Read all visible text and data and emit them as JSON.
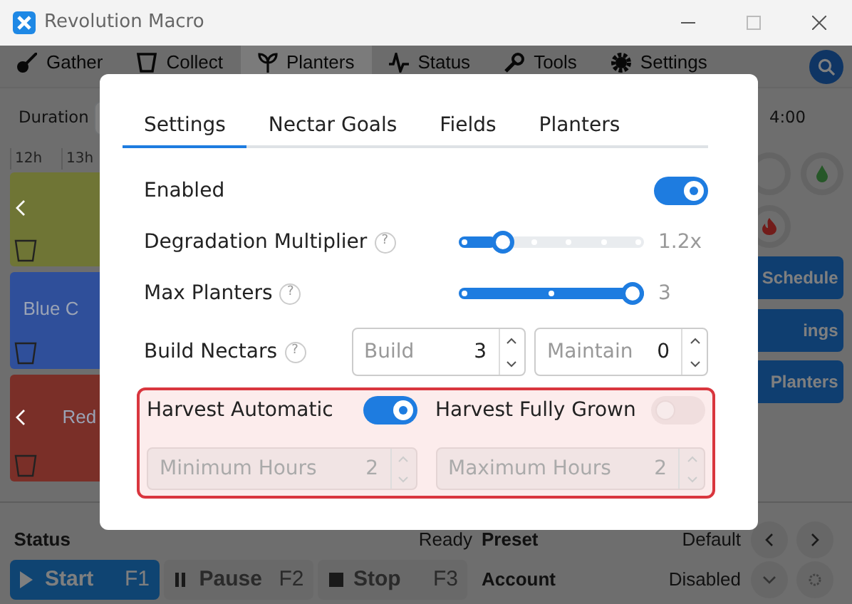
{
  "window": {
    "title": "Revolution Macro"
  },
  "nav_tabs": [
    {
      "label": "Gather",
      "selected": false
    },
    {
      "label": "Collect",
      "selected": false
    },
    {
      "label": "Planters",
      "selected": true
    },
    {
      "label": "Status",
      "selected": false
    },
    {
      "label": "Tools",
      "selected": false
    },
    {
      "label": "Settings",
      "selected": false
    }
  ],
  "toolbar": {
    "duration_label": "Duration",
    "time": "4:00"
  },
  "timeline": {
    "hours": [
      "12h",
      "13h"
    ],
    "planters": [
      {
        "color": "#6f7535"
      },
      {
        "label": "Blue C",
        "color": "#2f4f9a"
      },
      {
        "label": "Red",
        "color": "#7a2f28"
      }
    ]
  },
  "side_panel": {
    "buttons": [
      "Schedule",
      "ings",
      "Planters"
    ]
  },
  "status_bar": {
    "status_label": "Status",
    "status": "Ready",
    "preset_label": "Preset",
    "preset": "Default",
    "account_label": "Account",
    "account": "Disabled",
    "controls": [
      {
        "kind": "start",
        "label": "Start",
        "key": "F1"
      },
      {
        "kind": "pause",
        "label": "Pause",
        "key": "F2"
      },
      {
        "kind": "stop",
        "label": "Stop",
        "key": "F3"
      }
    ]
  },
  "dialog": {
    "tabs": [
      {
        "label": "Settings",
        "selected": true
      },
      {
        "label": "Nectar Goals",
        "selected": false
      },
      {
        "label": "Fields",
        "selected": false
      },
      {
        "label": "Planters",
        "selected": false
      }
    ],
    "settings": [
      {
        "kind": "switch",
        "label": "Enabled",
        "on": true
      },
      {
        "kind": "slider",
        "label": "Degradation Multiplier",
        "help": "?",
        "level": 0.2,
        "reading": "1.2x"
      },
      {
        "kind": "slider",
        "label": "Max Planters",
        "help": "?",
        "level": 1,
        "reading": "3"
      },
      {
        "kind": "pair",
        "label": "Build Nectars",
        "help": "?",
        "fields": [
          {
            "label": "Build",
            "value": "3"
          },
          {
            "label": "Maintain",
            "value": "0"
          }
        ]
      }
    ],
    "harvest": {
      "highlighted": true,
      "switches": [
        {
          "label": "Harvest Automatic",
          "on": true,
          "disabled": false
        },
        {
          "label": "Harvest Fully Grown",
          "on": false,
          "disabled": true
        }
      ],
      "fields": [
        {
          "label": "Minimum Hours",
          "value": "2",
          "disabled": true
        },
        {
          "label": "Maximum Hours",
          "value": "2",
          "disabled": true
        }
      ]
    }
  }
}
